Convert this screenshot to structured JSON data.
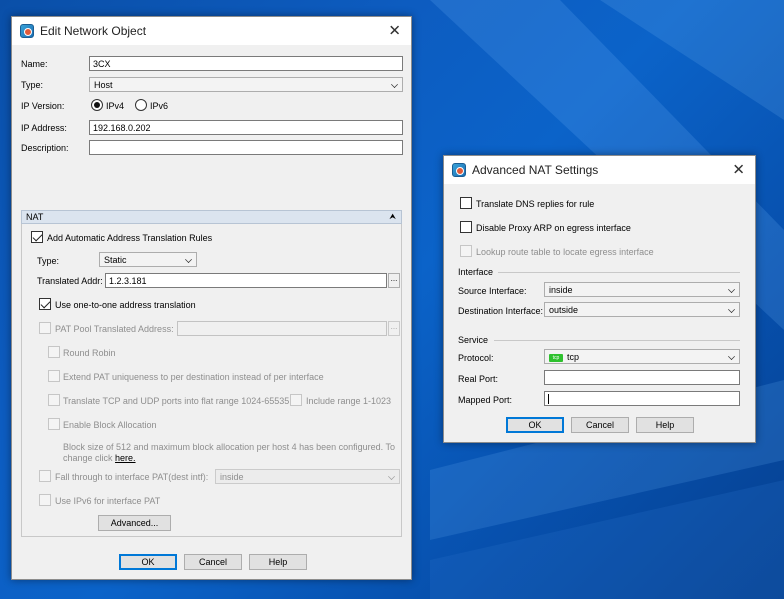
{
  "edit_dialog": {
    "title": "Edit Network Object",
    "name_label": "Name:",
    "name_value": "3CX",
    "type_label": "Type:",
    "type_value": "Host",
    "ip_version_label": "IP Version:",
    "ipv4_label": "IPv4",
    "ipv6_label": "IPv6",
    "ip_address_label": "IP Address:",
    "ip_address_value": "192.168.0.202",
    "description_label": "Description:",
    "description_value": "",
    "nat": {
      "header": "NAT",
      "add_auto_rules_label": "Add Automatic Address Translation Rules",
      "type_label": "Type:",
      "type_value": "Static",
      "translated_addr_label": "Translated Addr:",
      "translated_addr_value": "1.2.3.181",
      "one_to_one_label": "Use one-to-one address translation",
      "pat_pool_label": "PAT Pool Translated Address:",
      "round_robin_label": "Round Robin",
      "extend_pat_label": "Extend PAT uniqueness to per destination instead of per interface",
      "translate_tcp_udp_label": "Translate TCP and UDP ports into flat range 1024-65535",
      "include_range_label": "Include range 1-1023",
      "enable_block_label": "Enable Block Allocation",
      "block_info_line1": "Block size of 512 and maximum block allocation per host 4 has been configured. To",
      "block_info_line2": "change click ",
      "block_info_link": "here.",
      "fall_through_label": "Fall through to interface PAT(dest intf):",
      "fall_through_value": "inside",
      "ipv6_pat_label": "Use IPv6 for interface PAT",
      "advanced_button": "Advanced..."
    },
    "ok_button": "OK",
    "cancel_button": "Cancel",
    "help_button": "Help"
  },
  "advanced_dialog": {
    "title": "Advanced NAT Settings",
    "translate_dns_label": "Translate DNS replies for rule",
    "disable_proxy_arp_label": "Disable Proxy ARP on egress interface",
    "lookup_route_label": "Lookup route table to locate egress interface",
    "interface_group": "Interface",
    "source_interface_label": "Source Interface:",
    "source_interface_value": "inside",
    "destination_interface_label": "Destination Interface:",
    "destination_interface_value": "outside",
    "service_group": "Service",
    "protocol_label": "Protocol:",
    "protocol_icon_text": "tcp",
    "protocol_value": "tcp",
    "real_port_label": "Real Port:",
    "real_port_value": "",
    "mapped_port_label": "Mapped Port:",
    "mapped_port_value": "",
    "ok_button": "OK",
    "cancel_button": "Cancel",
    "help_button": "Help"
  },
  "colors": {
    "desktop_blue": "#0b63c9",
    "dialog_bg": "#f0f0f0",
    "default_button_border": "#0078d7",
    "nat_header_bg": "#dbe4ef",
    "tcp_badge": "#2ec12e"
  }
}
